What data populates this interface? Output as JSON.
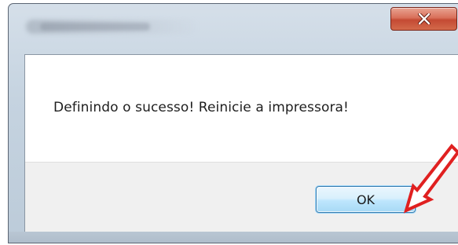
{
  "dialog": {
    "title": "",
    "message": "Definindo o sucesso! Reinicie a impressora!",
    "ok_label": "OK",
    "close_icon": "close-icon"
  },
  "annotation": {
    "arrow_icon": "red-arrow-icon",
    "arrow_color": "#e02020"
  },
  "colors": {
    "close_button": "#c9513a",
    "ok_border": "#3c7fb1"
  }
}
